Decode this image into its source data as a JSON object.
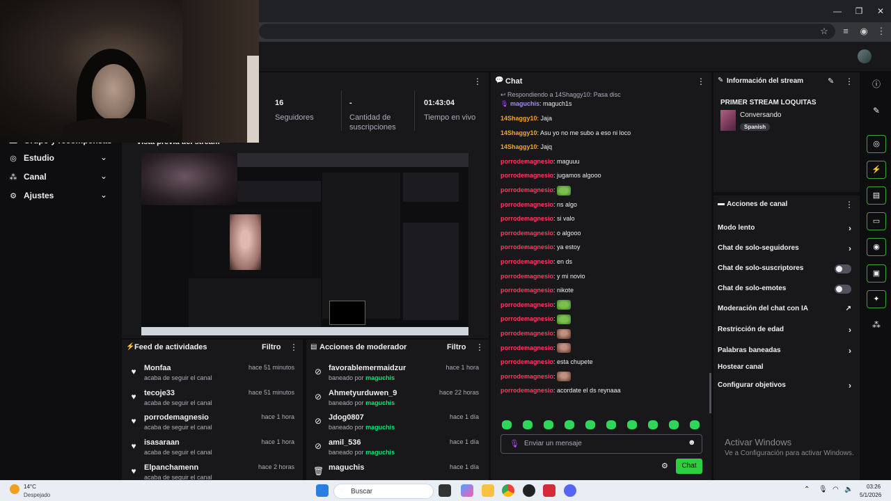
{
  "browser": {
    "minimize_glyph": "—",
    "restore_glyph": "❐",
    "close_glyph": "✕",
    "star_glyph": "☆",
    "menu_glyph": "⋮"
  },
  "nav": [
    {
      "label": "Grupo y recompensas",
      "icon": "gift-icon"
    },
    {
      "label": "Estudio",
      "icon": "studio-icon"
    },
    {
      "label": "Canal",
      "icon": "channel-icon"
    },
    {
      "label": "Ajustes",
      "icon": "gear-icon"
    }
  ],
  "stats": [
    {
      "value": "16",
      "label": "Seguidores"
    },
    {
      "value": "-",
      "label": "Cantidad de suscripciones"
    },
    {
      "value": "01:43:04",
      "label": "Tiempo en vivo"
    }
  ],
  "preview": {
    "title": "Vista previa del stream"
  },
  "activity_feed": {
    "title": "Feed de actividades",
    "filter": "Filtro",
    "items": [
      {
        "name": "Monfaa",
        "sub": "acaba de seguir el canal",
        "time": "hace 51 minutos"
      },
      {
        "name": "tecoje33",
        "sub": "acaba de seguir el canal",
        "time": "hace 51 minutos"
      },
      {
        "name": "porrodemagnesio",
        "sub": "acaba de seguir el canal",
        "time": "hace 1 hora"
      },
      {
        "name": "isasaraan",
        "sub": "acaba de seguir el canal",
        "time": "hace 1 hora"
      },
      {
        "name": "Elpanchamenn",
        "sub": "acaba de seguir el canal",
        "time": "hace 2 horas"
      }
    ]
  },
  "mod_actions": {
    "title": "Acciones de moderador",
    "filter": "Filtro",
    "banned_by_prefix": "baneado por",
    "items": [
      {
        "name": "favorablemermaidzur",
        "by": "maguchis",
        "time": "hace 1 hora"
      },
      {
        "name": "Ahmetyurduwen_9",
        "by": "maguchis",
        "time": "hace 22 horas"
      },
      {
        "name": "Jdog0807",
        "by": "maguchis",
        "time": "hace 1 día"
      },
      {
        "name": "amil_536",
        "by": "maguchis",
        "time": "hace 1 día"
      },
      {
        "name": "maguchis",
        "by": "",
        "time": "hace 1 día"
      }
    ]
  },
  "chat": {
    "title": "Chat",
    "reply_to": "Respondiendo a 14Shaggy10: Pasa disc",
    "reply_user": "maguchis",
    "reply_msg": "maguch1s",
    "messages": [
      {
        "user": "14Shaggy10",
        "color": "#f5a623",
        "text": "Jaja",
        "emote": ""
      },
      {
        "user": "14Shaggy10",
        "color": "#f5a623",
        "text": "Asu yo no me subo a eso ni loco",
        "emote": ""
      },
      {
        "user": "14Shaggy10",
        "color": "#f5a623",
        "text": "Jajq",
        "emote": ""
      },
      {
        "user": "porrodemagnesio",
        "color": "#ff3860",
        "text": "maguuu",
        "emote": ""
      },
      {
        "user": "porrodemagnesio",
        "color": "#ff3860",
        "text": "jugamos algooo",
        "emote": ""
      },
      {
        "user": "porrodemagnesio",
        "color": "#ff3860",
        "text": "",
        "emote": "frog"
      },
      {
        "user": "porrodemagnesio",
        "color": "#ff3860",
        "text": "ns algo",
        "emote": ""
      },
      {
        "user": "porrodemagnesio",
        "color": "#ff3860",
        "text": "si valo",
        "emote": ""
      },
      {
        "user": "porrodemagnesio",
        "color": "#ff3860",
        "text": "o algooo",
        "emote": ""
      },
      {
        "user": "porrodemagnesio",
        "color": "#ff3860",
        "text": "ya estoy",
        "emote": ""
      },
      {
        "user": "porrodemagnesio",
        "color": "#ff3860",
        "text": "en ds",
        "emote": ""
      },
      {
        "user": "porrodemagnesio",
        "color": "#ff3860",
        "text": "y mi novio",
        "emote": ""
      },
      {
        "user": "porrodemagnesio",
        "color": "#ff3860",
        "text": "nikote",
        "emote": ""
      },
      {
        "user": "porrodemagnesio",
        "color": "#ff3860",
        "text": "",
        "emote": "frog"
      },
      {
        "user": "porrodemagnesio",
        "color": "#ff3860",
        "text": "",
        "emote": "frog"
      },
      {
        "user": "porrodemagnesio",
        "color": "#ff3860",
        "text": "",
        "emote": "monkey"
      },
      {
        "user": "porrodemagnesio",
        "color": "#ff3860",
        "text": "",
        "emote": "monkey"
      },
      {
        "user": "porrodemagnesio",
        "color": "#ff3860",
        "text": "esta chupete",
        "emote": ""
      },
      {
        "user": "porrodemagnesio",
        "color": "#ff3860",
        "text": "",
        "emote": "monkey"
      },
      {
        "user": "porrodemagnesio",
        "color": "#ff3860",
        "text": "acordate el ds reynaaa",
        "emote": ""
      }
    ],
    "input_placeholder": "Enviar un mensaje",
    "send_label": "Chat"
  },
  "stream_info": {
    "title": "Información del stream",
    "stream_title": "PRIMER STREAM LOQUITAS",
    "category": "Conversando",
    "language": "Spanish"
  },
  "channel_actions": {
    "title": "Acciones de canal",
    "items": [
      {
        "label": "Modo lento",
        "control": "chevron"
      },
      {
        "label": "Chat de solo-seguidores",
        "control": "chevron"
      },
      {
        "label": "Chat de solo-suscriptores",
        "control": "toggle"
      },
      {
        "label": "Chat de solo-emotes",
        "control": "toggle"
      },
      {
        "label": "Moderación del chat con IA",
        "control": "external"
      },
      {
        "label": "Restricción de edad",
        "control": "chevron"
      },
      {
        "label": "Palabras baneadas",
        "control": "chevron"
      },
      {
        "label": "Hostear canal",
        "control": "none"
      },
      {
        "label": "Configurar objetivos",
        "control": "chevron"
      }
    ]
  },
  "watermark": {
    "line1": "Activar Windows",
    "line2": "Ve a Configuración para activar Windows."
  },
  "taskbar": {
    "weather_temp": "14°C",
    "weather_desc": "Despejado",
    "search_placeholder": "Buscar",
    "time": "03:26",
    "date": "5/1/2026"
  }
}
